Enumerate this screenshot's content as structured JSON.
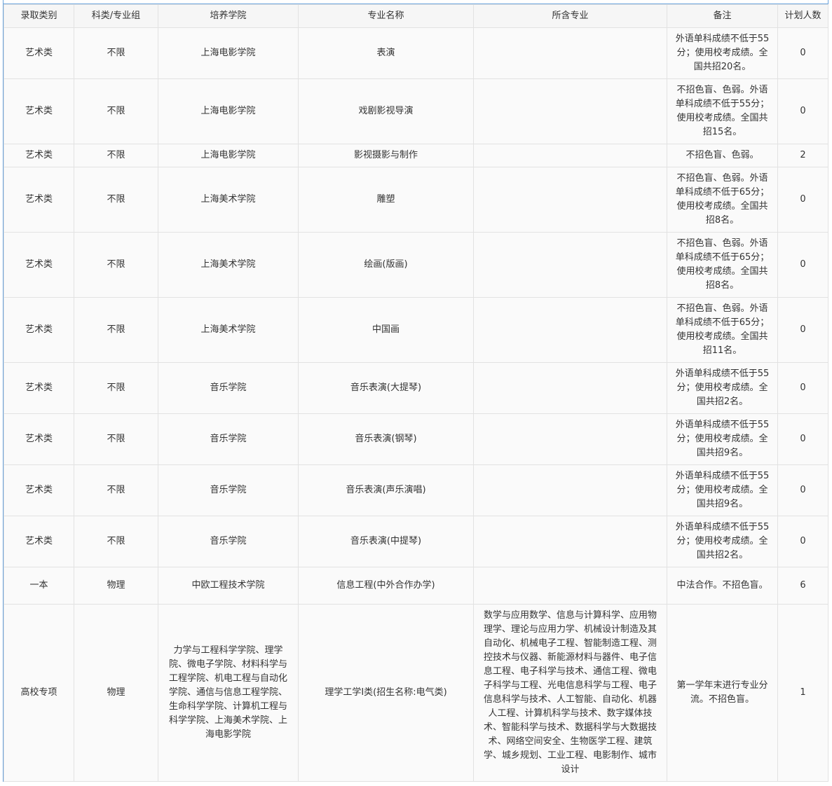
{
  "headers": [
    "录取类别",
    "科类/专业组",
    "培养学院",
    "专业名称",
    "所含专业",
    "备注",
    "计划人数"
  ],
  "rows": [
    {
      "category": "艺术类",
      "subject": "不限",
      "college": "上海电影学院",
      "major": "表演",
      "included": "",
      "remark": "外语单科成绩不低于55分；使用校考成绩。全国共招20名。",
      "plan": "0"
    },
    {
      "category": "艺术类",
      "subject": "不限",
      "college": "上海电影学院",
      "major": "戏剧影视导演",
      "included": "",
      "remark": "不招色盲、色弱。外语单科成绩不低于55分；使用校考成绩。全国共招15名。",
      "plan": "0"
    },
    {
      "category": "艺术类",
      "subject": "不限",
      "college": "上海电影学院",
      "major": "影视摄影与制作",
      "included": "",
      "remark": "不招色盲、色弱。",
      "plan": "2"
    },
    {
      "category": "艺术类",
      "subject": "不限",
      "college": "上海美术学院",
      "major": "雕塑",
      "included": "",
      "remark": "不招色盲、色弱。外语单科成绩不低于65分；使用校考成绩。全国共招8名。",
      "plan": "0"
    },
    {
      "category": "艺术类",
      "subject": "不限",
      "college": "上海美术学院",
      "major": "绘画(版画)",
      "included": "",
      "remark": "不招色盲、色弱。外语单科成绩不低于65分；使用校考成绩。全国共招8名。",
      "plan": "0"
    },
    {
      "category": "艺术类",
      "subject": "不限",
      "college": "上海美术学院",
      "major": "中国画",
      "included": "",
      "remark": "不招色盲、色弱。外语单科成绩不低于65分；使用校考成绩。全国共招11名。",
      "plan": "0"
    },
    {
      "category": "艺术类",
      "subject": "不限",
      "college": "音乐学院",
      "major": "音乐表演(大提琴)",
      "included": "",
      "remark": "外语单科成绩不低于55分；使用校考成绩。全国共招2名。",
      "plan": "0"
    },
    {
      "category": "艺术类",
      "subject": "不限",
      "college": "音乐学院",
      "major": "音乐表演(钢琴)",
      "included": "",
      "remark": "外语单科成绩不低于55分；使用校考成绩。全国共招9名。",
      "plan": "0"
    },
    {
      "category": "艺术类",
      "subject": "不限",
      "college": "音乐学院",
      "major": "音乐表演(声乐演唱)",
      "included": "",
      "remark": "外语单科成绩不低于55分；使用校考成绩。全国共招9名。",
      "plan": "0"
    },
    {
      "category": "艺术类",
      "subject": "不限",
      "college": "音乐学院",
      "major": "音乐表演(中提琴)",
      "included": "",
      "remark": "外语单科成绩不低于55分；使用校考成绩。全国共招2名。",
      "plan": "0"
    },
    {
      "category": "一本",
      "subject": "物理",
      "college": "中欧工程技术学院",
      "major": "信息工程(中外合作办学)",
      "included": "",
      "remark": "中法合作。不招色盲。",
      "plan": "6"
    },
    {
      "category": "高校专项",
      "subject": "物理",
      "college": "力学与工程科学学院、理学院、微电子学院、材料科学与工程学院、机电工程与自动化学院、通信与信息工程学院、生命科学学院、计算机工程与科学学院、上海美术学院、上海电影学院",
      "major": "理学工学I类(招生名称:电气类)",
      "included": "数学与应用数学、信息与计算科学、应用物理学、理论与应用力学、机械设计制造及其自动化、机械电子工程、智能制造工程、测控技术与仪器、新能源材料与器件、电子信息工程、电子科学与技术、通信工程、微电子科学与工程、光电信息科学与工程、电子信息科学与技术、人工智能、自动化、机器人工程、计算机科学与技术、数字媒体技术、智能科学与技术、数据科学与大数据技术、网络空间安全、生物医学工程、建筑学、城乡规划、工业工程、电影制作、城市设计",
      "remark": "第一学年末进行专业分流。不招色盲。",
      "plan": "1"
    }
  ]
}
